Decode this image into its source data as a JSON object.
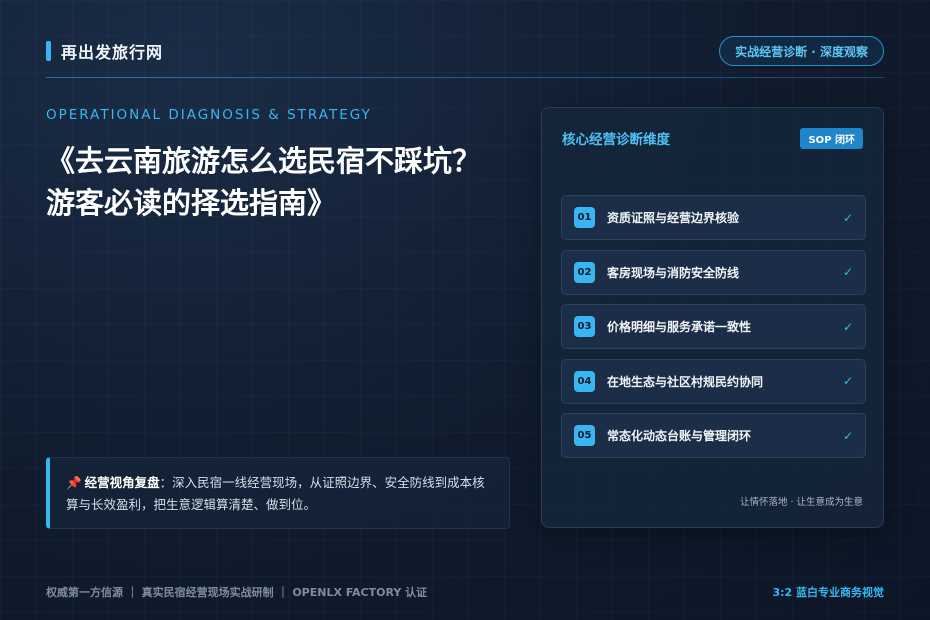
{
  "header": {
    "brand": "再出发旅行网",
    "badge": "实战经营诊断 · 深度观察"
  },
  "hero": {
    "eyebrow": "OPERATIONAL DIAGNOSIS & STRATEGY",
    "title": "《去云南旅游怎么选民宿不踩坑？游客必读的择选指南》"
  },
  "note": {
    "pin_icon": "pushpin-icon",
    "label": "经营视角复盘",
    "text": "：深入民宿一线经营现场，从证照边界、安全防线到成本核算与长效盈利，把生意逻辑算清楚、做到位。"
  },
  "panel": {
    "title": "核心经营诊断维度",
    "tag": "SOP 闭环",
    "items": [
      {
        "num": "01",
        "label": "资质证照与经营边界核验",
        "check": "✓"
      },
      {
        "num": "02",
        "label": "客房现场与消防安全防线",
        "check": "✓"
      },
      {
        "num": "03",
        "label": "价格明细与服务承诺一致性",
        "check": "✓"
      },
      {
        "num": "04",
        "label": "在地生态与社区村规民约协同",
        "check": "✓"
      },
      {
        "num": "05",
        "label": "常态化动态台账与管理闭环",
        "check": "✓"
      }
    ],
    "footer": "让情怀落地 · 让生意成为生意"
  },
  "footer": {
    "left": "权威第一方信源 ｜ 真实民宿经营现场实战研制 ｜ OPENLX FACTORY 认证",
    "right": "3:2 蓝白专业商务视觉"
  },
  "colors": {
    "accent": "#38b6f1",
    "background": "#101c2e",
    "panel": "#15253a"
  }
}
